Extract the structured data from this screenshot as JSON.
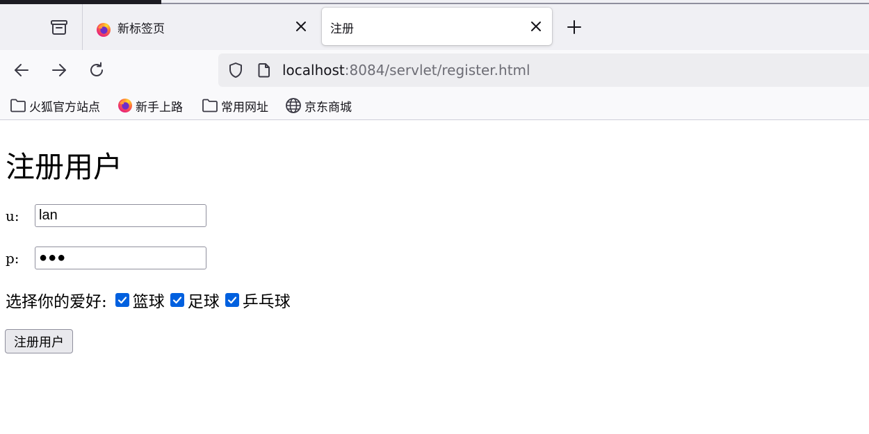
{
  "browser": {
    "tabs": [
      {
        "title": "新标签页",
        "favicon": "firefox-icon",
        "active": false
      },
      {
        "title": "注册",
        "favicon": "",
        "active": true
      }
    ],
    "address": {
      "host": "localhost",
      "rest": ":8084/servlet/register.html"
    },
    "bookmarks": [
      {
        "label": "火狐官方站点",
        "icon": "folder-icon"
      },
      {
        "label": "新手上路",
        "icon": "firefox-icon"
      },
      {
        "label": "常用网址",
        "icon": "folder-icon"
      },
      {
        "label": "京东商城",
        "icon": "globe-icon"
      }
    ],
    "colors": {
      "accent": "#0060df",
      "tabstrip": "#f0f0f4",
      "toolbar": "#f9f9fb"
    }
  },
  "page": {
    "heading": "注册用户",
    "username": {
      "label": "u:",
      "value": "lan"
    },
    "password": {
      "label": "p:",
      "masked_value": "●●●"
    },
    "hobbies": {
      "label": "选择你的爱好:",
      "options": [
        {
          "label": "篮球",
          "checked": true
        },
        {
          "label": "足球",
          "checked": true
        },
        {
          "label": "乒乓球",
          "checked": true
        }
      ]
    },
    "submit_label": "注册用户"
  }
}
